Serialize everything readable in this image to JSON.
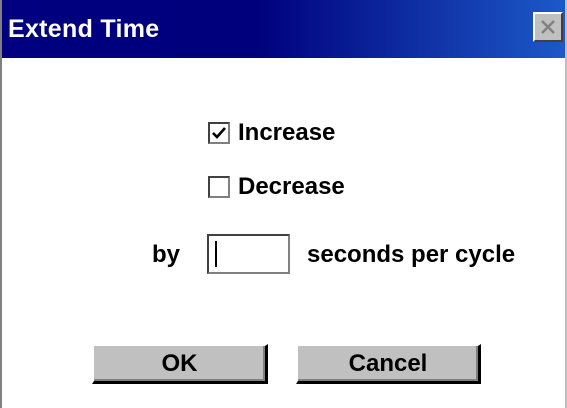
{
  "window": {
    "title": "Extend Time",
    "close_icon": "close-x-icon"
  },
  "options": {
    "increase": {
      "label": "Increase",
      "checked": true
    },
    "decrease": {
      "label": "Decrease",
      "checked": false
    }
  },
  "amount": {
    "prefix_label": "by",
    "value": "",
    "suffix_label": "seconds per cycle"
  },
  "buttons": {
    "ok_label": "OK",
    "cancel_label": "Cancel"
  },
  "colors": {
    "title_bar_start": "#000080",
    "title_bar_end": "#1c59c8",
    "button_face": "#c0c0c0"
  }
}
